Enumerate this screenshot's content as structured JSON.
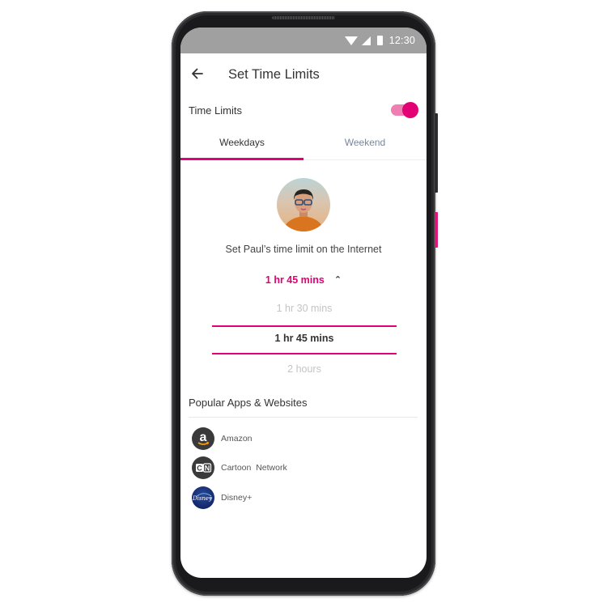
{
  "statusbar": {
    "time": "12:30",
    "icons": [
      "wifi-icon",
      "signal-icon",
      "battery-icon"
    ]
  },
  "appbar": {
    "back_icon": "arrow-left-icon",
    "title": "Set Time Limits"
  },
  "time_limits": {
    "label": "Time Limits",
    "enabled": true
  },
  "tabs": [
    {
      "label": "Weekdays",
      "active": true
    },
    {
      "label": "Weekend",
      "active": false
    }
  ],
  "child": {
    "name": "Paul",
    "prompt": "Set Paul’s time limit on the Internet"
  },
  "limit": {
    "selected": "1 hr 45 mins",
    "expanded_icon": "chevron-up-icon",
    "options": [
      "1 hr 30 mins",
      "1 hr 45 mins",
      "2 hours"
    ],
    "selected_index": 1
  },
  "popular": {
    "title": "Popular Apps & Websites",
    "apps": [
      {
        "name": "Amazon",
        "icon": "amazon-logo-icon"
      },
      {
        "name": "Cartoon  Network",
        "icon": "cartoon-network-logo-icon"
      },
      {
        "name": "Disney+",
        "icon": "disney-plus-logo-icon"
      }
    ]
  },
  "colors": {
    "accent": "#e20074",
    "accent_light": "#ef7fb3",
    "statusbar": "#a0a0a0",
    "tab_inactive": "#7a869a"
  }
}
